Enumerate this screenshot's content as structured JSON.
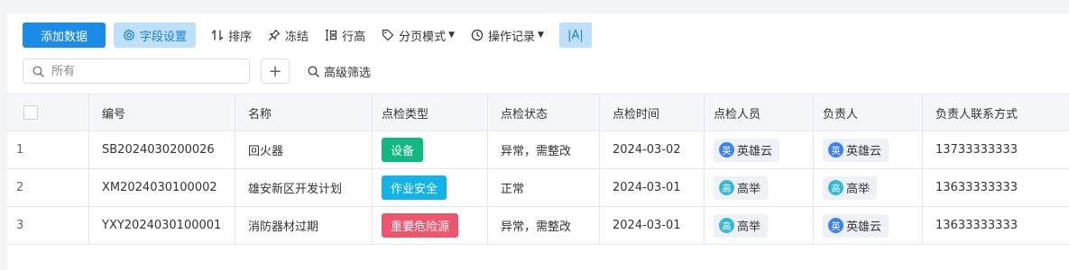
{
  "toolbar": {
    "add_label": "添加数据",
    "fields_label": "字段设置",
    "sort_label": "排序",
    "freeze_label": "冻结",
    "row_height_label": "行高",
    "pagination_label": "分页模式",
    "history_label": "操作记录",
    "text_toggle_label": "|A|"
  },
  "search": {
    "placeholder": "所有",
    "value": ""
  },
  "advanced_filter_label": "高级筛选",
  "columns": [
    "编号",
    "名称",
    "点检类型",
    "点检状态",
    "点检时间",
    "点检人员",
    "负责人",
    "负责人联系方式"
  ],
  "rows": [
    {
      "num": "1",
      "code": "SB2024030200026",
      "name": "回火器",
      "type": "设备",
      "type_color": "#10b981",
      "status": "异常，需整改",
      "date": "2024-03-02",
      "inspector": "英雄云",
      "inspector_initial": "英",
      "owner": "英雄云",
      "owner_initial": "英",
      "phone": "13733333333"
    },
    {
      "num": "2",
      "code": "XM2024030100002",
      "name": "雄安新区开发计划",
      "type": "作业安全",
      "type_color": "#12b3e8",
      "status": "正常",
      "date": "2024-03-01",
      "inspector": "高举",
      "inspector_initial": "高",
      "owner": "高举",
      "owner_initial": "高",
      "phone": "13633333333"
    },
    {
      "num": "3",
      "code": "YXY2024030100001",
      "name": "消防器材过期",
      "type": "重要危险源",
      "type_color": "#f0556e",
      "status": "异常，需整改",
      "date": "2024-03-01",
      "inspector": "高举",
      "inspector_initial": "高",
      "owner": "英雄云",
      "owner_initial": "英",
      "phone": "13633333333"
    }
  ],
  "colors": {
    "primary": "#1a8ce8",
    "avatar_ying": "#3b82f6",
    "avatar_gao": "#34b7d8"
  }
}
